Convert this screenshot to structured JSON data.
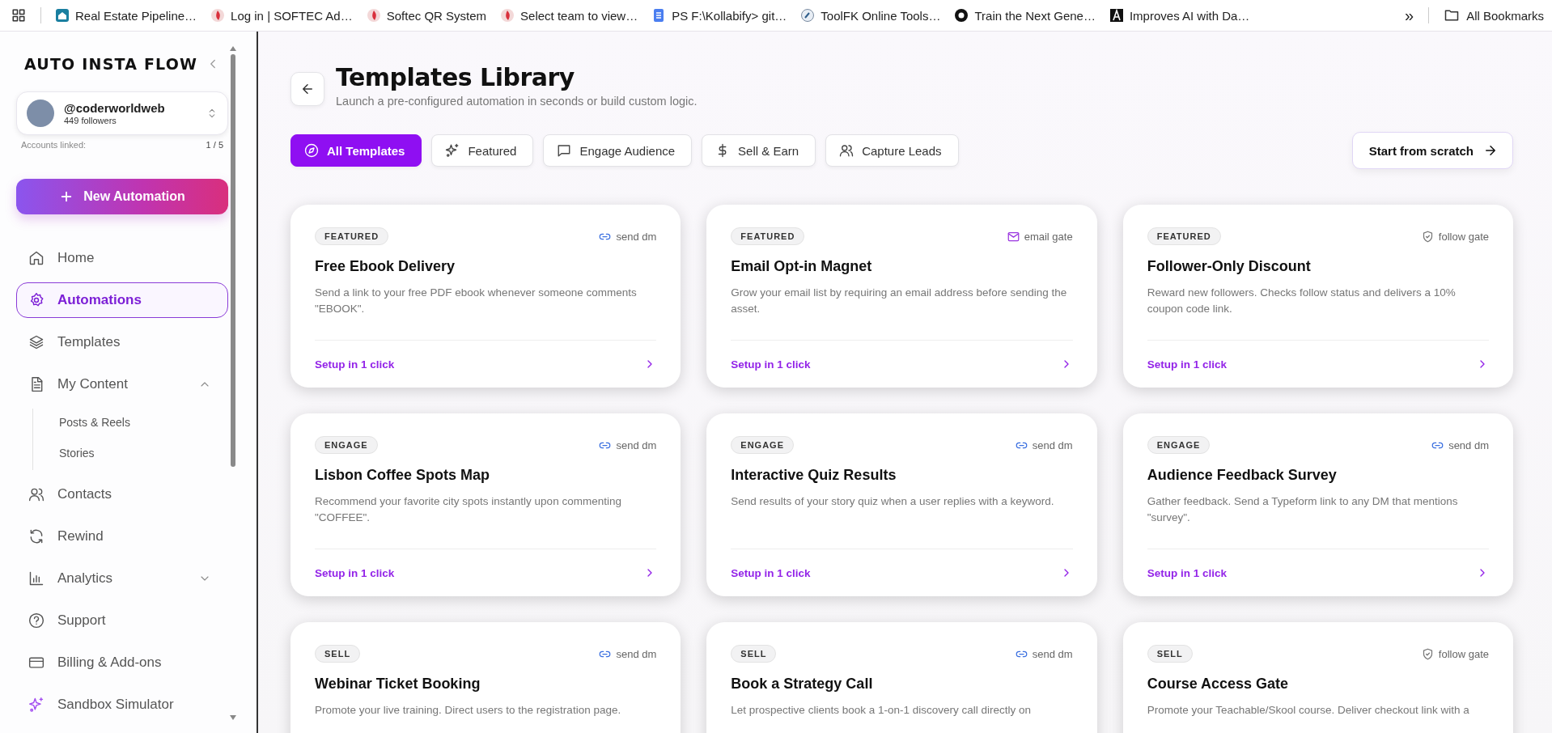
{
  "bookmarks_bar": {
    "items": [
      {
        "label": "Real Estate Pipeline…",
        "kind": "house"
      },
      {
        "label": "Log in | SOFTEC Ad…",
        "kind": "flame"
      },
      {
        "label": "Softec QR System",
        "kind": "flame"
      },
      {
        "label": "Select team to view…",
        "kind": "flame"
      },
      {
        "label": "PS F:\\Kollabify> git…",
        "kind": "doc"
      },
      {
        "label": "ToolFK Online Tools…",
        "kind": "tool"
      },
      {
        "label": "Train the Next Gene…",
        "kind": "ring"
      },
      {
        "label": "Improves AI with Da…",
        "kind": "letter"
      }
    ],
    "overflow": "»",
    "all_bookmarks": "All Bookmarks"
  },
  "sidebar": {
    "brand": "AUTO INSTA FLOW",
    "account": {
      "handle": "@coderworldweb",
      "followers": "449 followers",
      "linked_label": "Accounts linked:",
      "linked_count": "1 / 5"
    },
    "new_button": "New Automation",
    "items": [
      {
        "label": "Home",
        "kind": "link",
        "selected": false
      },
      {
        "label": "Automations",
        "kind": "link",
        "selected": true
      },
      {
        "label": "Templates",
        "kind": "link",
        "selected": false
      },
      {
        "label": "My Content",
        "kind": "group",
        "selected": false,
        "expanded": true,
        "children": [
          {
            "label": "Posts & Reels",
            "selected": false
          },
          {
            "label": "Stories",
            "selected": false
          }
        ]
      },
      {
        "label": "Contacts",
        "kind": "link",
        "selected": false
      },
      {
        "label": "Rewind",
        "kind": "link",
        "selected": false
      },
      {
        "label": "Analytics",
        "kind": "group",
        "selected": false,
        "expanded": false
      },
      {
        "label": "Support",
        "kind": "link",
        "selected": false
      },
      {
        "label": "Billing & Add-ons",
        "kind": "link",
        "selected": false
      },
      {
        "label": "Sandbox Simulator",
        "kind": "link",
        "selected": false
      }
    ]
  },
  "header": {
    "title": "Templates Library",
    "subtitle": "Launch a pre-configured automation in seconds or build custom logic."
  },
  "tabs": [
    {
      "label": "All Templates",
      "selected": true
    },
    {
      "label": "Featured",
      "selected": false
    },
    {
      "label": "Engage Audience",
      "selected": false
    },
    {
      "label": "Sell & Earn",
      "selected": false
    },
    {
      "label": "Capture Leads",
      "selected": false
    }
  ],
  "start_button": "Start from scratch",
  "cards": [
    {
      "tag": "FEATURED",
      "channel": {
        "kind": "link",
        "label": "send dm"
      },
      "title": "Free Ebook Delivery",
      "description": "Send a link to your free PDF ebook whenever someone comments \"EBOOK\".",
      "action": "Setup in 1 click"
    },
    {
      "tag": "FEATURED",
      "channel": {
        "kind": "email",
        "label": "email gate"
      },
      "title": "Email Opt-in Magnet",
      "description": "Grow your email list by requiring an email address before sending the asset.",
      "action": "Setup in 1 click"
    },
    {
      "tag": "FEATURED",
      "channel": {
        "kind": "shield",
        "label": "follow gate"
      },
      "title": "Follower-Only Discount",
      "description": "Reward new followers. Checks follow status and delivers a 10% coupon code link.",
      "action": "Setup in 1 click"
    },
    {
      "tag": "ENGAGE",
      "channel": {
        "kind": "link",
        "label": "send dm"
      },
      "title": "Lisbon Coffee Spots Map",
      "description": "Recommend your favorite city spots instantly upon commenting \"COFFEE\".",
      "action": "Setup in 1 click"
    },
    {
      "tag": "ENGAGE",
      "channel": {
        "kind": "link",
        "label": "send dm"
      },
      "title": "Interactive Quiz Results",
      "description": "Send results of your story quiz when a user replies with a keyword.",
      "action": "Setup in 1 click"
    },
    {
      "tag": "ENGAGE",
      "channel": {
        "kind": "link",
        "label": "send dm"
      },
      "title": "Audience Feedback Survey",
      "description": "Gather feedback. Send a Typeform link to any DM that mentions \"survey\".",
      "action": "Setup in 1 click"
    },
    {
      "tag": "SELL",
      "channel": {
        "kind": "link",
        "label": "send dm"
      },
      "title": "Webinar Ticket Booking",
      "description": "Promote your live training. Direct users to the registration page."
    },
    {
      "tag": "SELL",
      "channel": {
        "kind": "link",
        "label": "send dm"
      },
      "title": "Book a Strategy Call",
      "description": "Let prospective clients book a 1-on-1 discovery call directly on"
    },
    {
      "tag": "SELL",
      "channel": {
        "kind": "shield",
        "label": "follow gate"
      },
      "title": "Course Access Gate",
      "description": "Promote your Teachable/Skool course. Deliver checkout link with a"
    }
  ]
}
